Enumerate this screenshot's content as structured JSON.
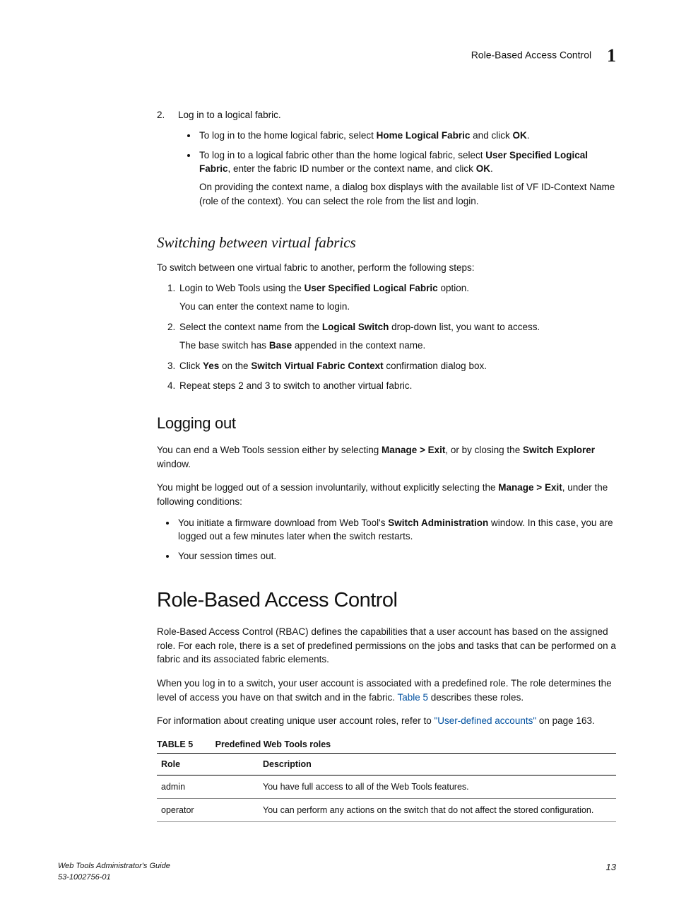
{
  "runhead": {
    "title": "Role-Based Access Control",
    "chapnum": "1"
  },
  "step2": {
    "num": "2.",
    "lead": "Log in to a logical fabric.",
    "b1_a": "To log in to the home logical fabric, select ",
    "b1_bold1": "Home Logical Fabric",
    "b1_b": " and click ",
    "b1_bold2": "OK",
    "b1_c": ".",
    "b2_a": "To log in to a logical fabric other than the home logical fabric, select ",
    "b2_bold1": "User Specified Logical Fabric",
    "b2_b": ", enter the fabric ID number or the context name, and click ",
    "b2_bold2": "OK",
    "b2_c": ".",
    "b2_note": "On providing the context name, a dialog box displays with the available list of VF ID-Context Name (role of the context). You can select the role from the list and login."
  },
  "switching": {
    "title": "Switching between virtual fabrics",
    "intro": "To switch between one virtual fabric to another, perform the following steps:",
    "s1_a": "Login to Web Tools using the ",
    "s1_bold": "User Specified Logical Fabric",
    "s1_b": " option.",
    "s1_note": "You can enter the context name to login.",
    "s2_a": "Select the context name from the ",
    "s2_bold": "Logical Switch",
    "s2_b": " drop-down list, you want to access.",
    "s2_note_a": "The base switch has ",
    "s2_note_bold": "Base",
    "s2_note_b": " appended in the context name.",
    "s3_a": "Click ",
    "s3_bold1": "Yes",
    "s3_b": " on the ",
    "s3_bold2": "Switch Virtual Fabric Context",
    "s3_c": " confirmation dialog box.",
    "s4": "Repeat steps 2 and 3 to switch to another virtual fabric."
  },
  "logging": {
    "title": "Logging out",
    "p1_a": "You can end a Web Tools session either by selecting ",
    "p1_bold1": "Manage > Exit",
    "p1_b": ", or by closing the ",
    "p1_bold2": "Switch Explorer",
    "p1_c": " window.",
    "p2_a": "You might be logged out of a session involuntarily, without explicitly selecting the ",
    "p2_bold": "Manage > Exit",
    "p2_b": ", under the following conditions:",
    "b1_a": "You initiate a firmware download from Web Tool's ",
    "b1_bold": "Switch Administration",
    "b1_b": " window. In this case, you are logged out a few minutes later when the switch restarts.",
    "b2": "Your session times out."
  },
  "rbac": {
    "title": "Role-Based Access Control",
    "p1": "Role-Based Access Control (RBAC) defines the capabilities that a user account has based on the assigned role. For each role, there is a set of predefined permissions on the jobs and tasks that can be performed on a fabric and its associated fabric elements.",
    "p2_a": "When you log in to a switch, your user account is associated with a predefined role. The role determines the level of access you have on that switch and in the fabric. ",
    "p2_link": "Table 5",
    "p2_b": " describes these roles.",
    "p3_a": "For information about creating unique user account roles, refer to ",
    "p3_link": "\"User-defined accounts\"",
    "p3_b": " on page 163."
  },
  "table": {
    "label": "TABLE 5",
    "caption": "Predefined Web Tools roles",
    "h1": "Role",
    "h2": "Description",
    "rows": [
      {
        "role": "admin",
        "desc": "You have full access to all of the Web Tools features."
      },
      {
        "role": "operator",
        "desc": "You can perform any actions on the switch that do not affect the stored configuration."
      }
    ]
  },
  "footer": {
    "line1": "Web Tools Administrator's Guide",
    "line2": "53-1002756-01",
    "page": "13"
  }
}
